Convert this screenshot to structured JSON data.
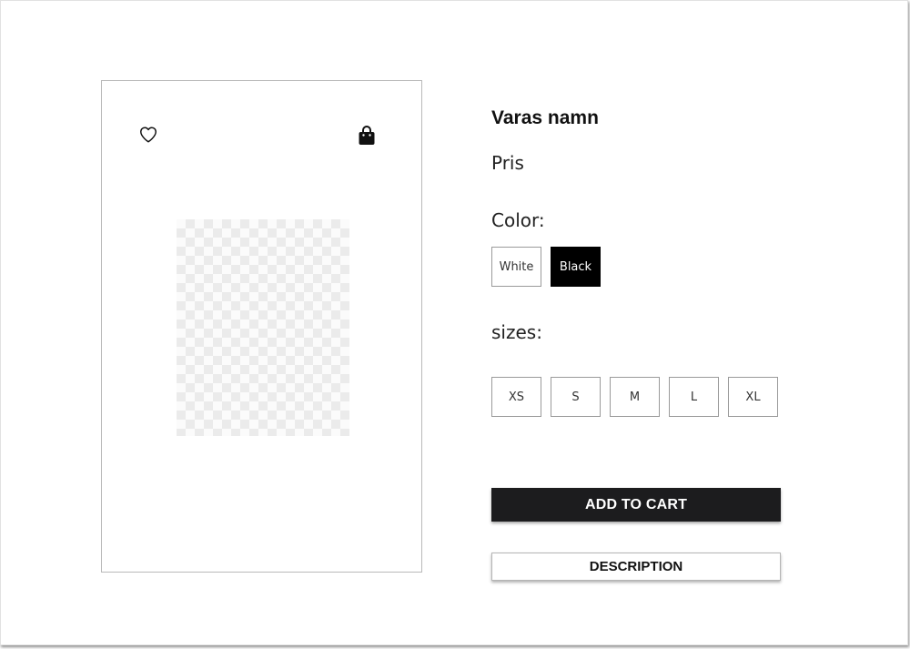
{
  "product": {
    "title": "Varas namn",
    "price": "Pris",
    "icons": {
      "favorite": "heart-outline-icon",
      "cart": "shopping-bag-icon"
    }
  },
  "color": {
    "label": "Color:",
    "options": [
      "White",
      "Black"
    ],
    "selected": "Black"
  },
  "sizes": {
    "label": "sizes:",
    "options": [
      "XS",
      "S",
      "M",
      "L",
      "XL"
    ]
  },
  "actions": {
    "add_to_cart": "ADD TO CART",
    "description": "DESCRIPTION"
  },
  "colors": {
    "primary_button": "#1c1c1e",
    "selected_swatch": "#000000",
    "border": "#9a9a9a"
  }
}
